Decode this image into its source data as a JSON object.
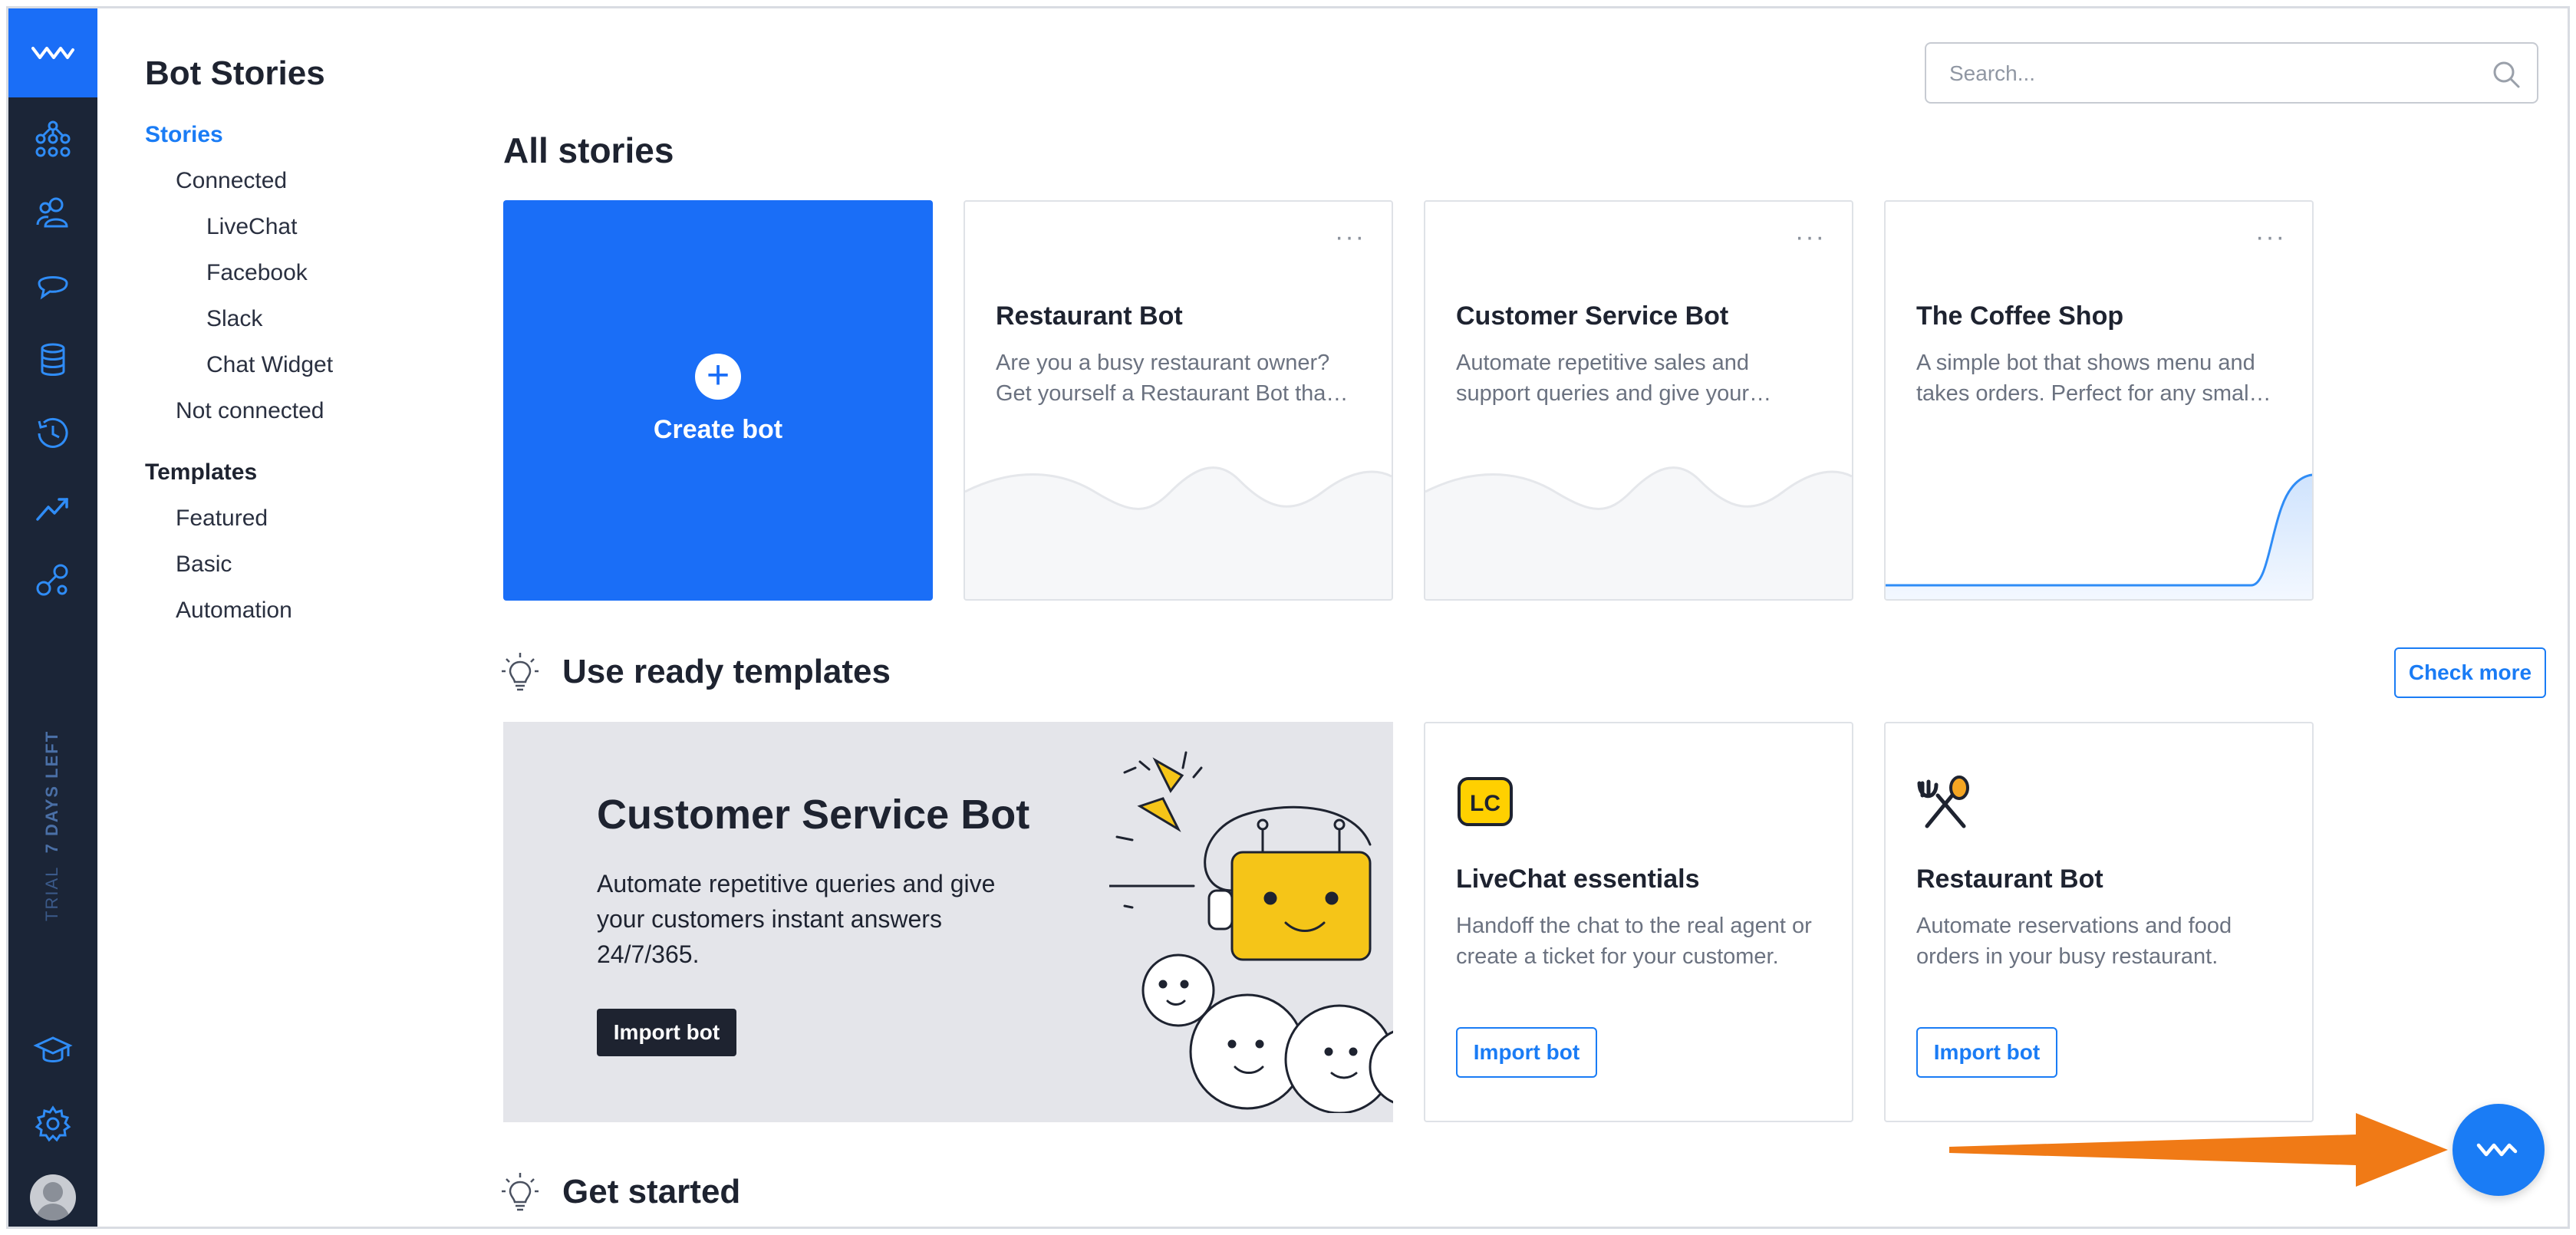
{
  "rail": {
    "icons": [
      "bot-logo-icon",
      "stories-icon",
      "users-icon",
      "chat-icon",
      "database-icon",
      "history-icon",
      "trend-icon",
      "integrations-icon",
      "academy-icon",
      "settings-icon"
    ],
    "trial_label": "TRIAL",
    "trial_days": "7 DAYS LEFT"
  },
  "sidenav": {
    "title": "Bot Stories",
    "items": [
      {
        "label": "Stories"
      },
      {
        "label": "Connected"
      },
      {
        "label": "LiveChat"
      },
      {
        "label": "Facebook"
      },
      {
        "label": "Slack"
      },
      {
        "label": "Chat Widget"
      },
      {
        "label": "Not connected"
      },
      {
        "label": "Templates"
      },
      {
        "label": "Featured"
      },
      {
        "label": "Basic"
      },
      {
        "label": "Automation"
      }
    ]
  },
  "search": {
    "placeholder": "Search..."
  },
  "main": {
    "all_stories_heading": "All stories",
    "create_label": "Create bot",
    "stories": [
      {
        "title": "Restaurant Bot",
        "description": "Are you a busy restaurant owner? Get yourself a Restaurant Bot tha…",
        "menu": "···"
      },
      {
        "title": "Customer Service Bot",
        "description": "Automate repetitive sales and support queries and give your…",
        "menu": "···"
      },
      {
        "title": "The Coffee Shop",
        "description": "A simple bot that shows menu and takes orders. Perfect for any smal…",
        "menu": "···"
      }
    ],
    "templates_heading": "Use ready templates",
    "check_more": "Check more",
    "featured": {
      "title": "Customer Service Bot",
      "description": "Automate repetitive queries and give your customers instant answers 24/7/365.",
      "button": "Import bot"
    },
    "templates": [
      {
        "title": "LiveChat essentials",
        "description": "Handoff the chat to the real agent or create a ticket for your customer.",
        "button": "Import bot",
        "icon": "livechat-logo-icon",
        "icon_text": "LC"
      },
      {
        "title": "Restaurant Bot",
        "description": "Automate reservations and food orders in your busy restaurant.",
        "button": "Import bot",
        "icon": "fork-spoon-icon"
      }
    ],
    "get_started_heading": "Get started"
  },
  "colors": {
    "rail": "#1b2537",
    "primary": "#1a6ef7",
    "link": "#1a7cf5",
    "arrow": "#f07a16"
  }
}
